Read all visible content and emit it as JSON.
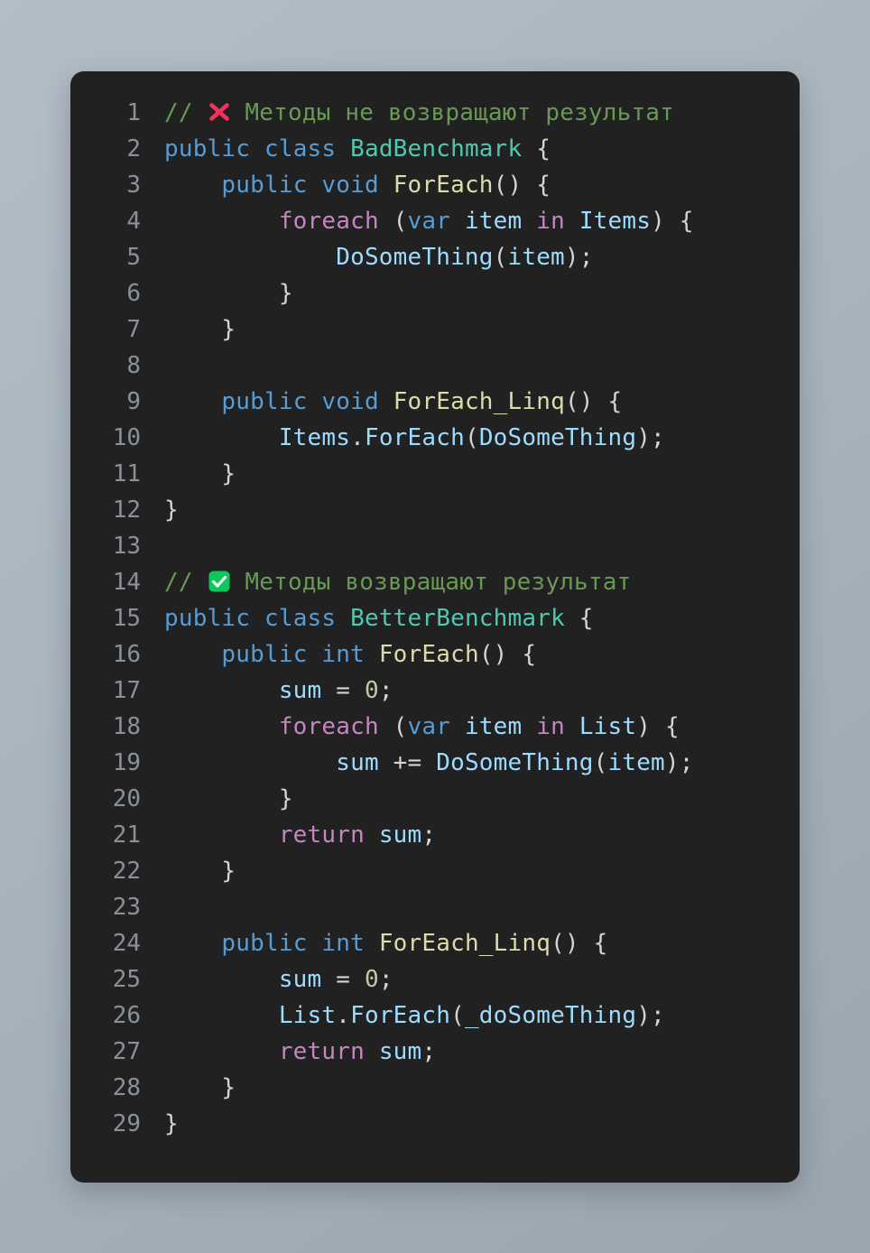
{
  "theme": {
    "page_background": "#aab5bf",
    "card_background": "#212121",
    "gutter_color": "#8a9199",
    "comment": "#6a9955",
    "keyword": "#569cd6",
    "control": "#c586c0",
    "type": "#4ec9b0",
    "method": "#dcdcaa",
    "variable": "#9cdcfe",
    "number": "#b5cea8",
    "punctuation": "#d4d4d4",
    "cross_mark_color": "#f5325b",
    "check_mark_color": "#0ac85b"
  },
  "code": {
    "language": "csharp",
    "line_count": 29,
    "lines": [
      {
        "number": "1",
        "indent": 0,
        "tokens": [
          {
            "text": "// ",
            "kind": "comment"
          },
          {
            "text": "❌",
            "kind": "emoji",
            "icon": "cross-mark-icon"
          },
          {
            "text": " Методы не возвращают результат",
            "kind": "comment"
          }
        ]
      },
      {
        "number": "2",
        "indent": 0,
        "tokens": [
          {
            "text": "public",
            "kind": "keyword"
          },
          {
            "text": " ",
            "kind": "punct"
          },
          {
            "text": "class",
            "kind": "keyword"
          },
          {
            "text": " ",
            "kind": "punct"
          },
          {
            "text": "BadBenchmark",
            "kind": "type"
          },
          {
            "text": " {",
            "kind": "punct"
          }
        ]
      },
      {
        "number": "3",
        "indent": 1,
        "tokens": [
          {
            "text": "public",
            "kind": "keyword"
          },
          {
            "text": " ",
            "kind": "punct"
          },
          {
            "text": "void",
            "kind": "keyword"
          },
          {
            "text": " ",
            "kind": "punct"
          },
          {
            "text": "ForEach",
            "kind": "method"
          },
          {
            "text": "() {",
            "kind": "punct"
          }
        ]
      },
      {
        "number": "4",
        "indent": 2,
        "tokens": [
          {
            "text": "foreach",
            "kind": "control"
          },
          {
            "text": " (",
            "kind": "punct"
          },
          {
            "text": "var",
            "kind": "keyword"
          },
          {
            "text": " ",
            "kind": "punct"
          },
          {
            "text": "item",
            "kind": "variable"
          },
          {
            "text": " ",
            "kind": "punct"
          },
          {
            "text": "in",
            "kind": "control"
          },
          {
            "text": " ",
            "kind": "punct"
          },
          {
            "text": "Items",
            "kind": "variable"
          },
          {
            "text": ") {",
            "kind": "punct"
          }
        ]
      },
      {
        "number": "5",
        "indent": 3,
        "tokens": [
          {
            "text": "DoSomeThing",
            "kind": "variable"
          },
          {
            "text": "(",
            "kind": "punct"
          },
          {
            "text": "item",
            "kind": "variable"
          },
          {
            "text": ");",
            "kind": "punct"
          }
        ]
      },
      {
        "number": "6",
        "indent": 2,
        "tokens": [
          {
            "text": "}",
            "kind": "punct"
          }
        ]
      },
      {
        "number": "7",
        "indent": 1,
        "tokens": [
          {
            "text": "}",
            "kind": "punct"
          }
        ]
      },
      {
        "number": "8",
        "indent": 0,
        "tokens": []
      },
      {
        "number": "9",
        "indent": 1,
        "tokens": [
          {
            "text": "public",
            "kind": "keyword"
          },
          {
            "text": " ",
            "kind": "punct"
          },
          {
            "text": "void",
            "kind": "keyword"
          },
          {
            "text": " ",
            "kind": "punct"
          },
          {
            "text": "ForEach_Linq",
            "kind": "method"
          },
          {
            "text": "() {",
            "kind": "punct"
          }
        ]
      },
      {
        "number": "10",
        "indent": 2,
        "tokens": [
          {
            "text": "Items",
            "kind": "variable"
          },
          {
            "text": ".",
            "kind": "punct"
          },
          {
            "text": "ForEach",
            "kind": "variable"
          },
          {
            "text": "(",
            "kind": "punct"
          },
          {
            "text": "DoSomeThing",
            "kind": "variable"
          },
          {
            "text": ");",
            "kind": "punct"
          }
        ]
      },
      {
        "number": "11",
        "indent": 1,
        "tokens": [
          {
            "text": "}",
            "kind": "punct"
          }
        ]
      },
      {
        "number": "12",
        "indent": 0,
        "tokens": [
          {
            "text": "}",
            "kind": "punct"
          }
        ]
      },
      {
        "number": "13",
        "indent": 0,
        "tokens": []
      },
      {
        "number": "14",
        "indent": 0,
        "tokens": [
          {
            "text": "// ",
            "kind": "comment"
          },
          {
            "text": "✅",
            "kind": "emoji",
            "icon": "check-mark-icon"
          },
          {
            "text": " Методы возвращают результат",
            "kind": "comment"
          }
        ]
      },
      {
        "number": "15",
        "indent": 0,
        "tokens": [
          {
            "text": "public",
            "kind": "keyword"
          },
          {
            "text": " ",
            "kind": "punct"
          },
          {
            "text": "class",
            "kind": "keyword"
          },
          {
            "text": " ",
            "kind": "punct"
          },
          {
            "text": "BetterBenchmark",
            "kind": "type"
          },
          {
            "text": " {",
            "kind": "punct"
          }
        ]
      },
      {
        "number": "16",
        "indent": 1,
        "tokens": [
          {
            "text": "public",
            "kind": "keyword"
          },
          {
            "text": " ",
            "kind": "punct"
          },
          {
            "text": "int",
            "kind": "keyword"
          },
          {
            "text": " ",
            "kind": "punct"
          },
          {
            "text": "ForEach",
            "kind": "method"
          },
          {
            "text": "() {",
            "kind": "punct"
          }
        ]
      },
      {
        "number": "17",
        "indent": 2,
        "tokens": [
          {
            "text": "sum",
            "kind": "variable"
          },
          {
            "text": " = ",
            "kind": "punct"
          },
          {
            "text": "0",
            "kind": "number"
          },
          {
            "text": ";",
            "kind": "punct"
          }
        ]
      },
      {
        "number": "18",
        "indent": 2,
        "tokens": [
          {
            "text": "foreach",
            "kind": "control"
          },
          {
            "text": " (",
            "kind": "punct"
          },
          {
            "text": "var",
            "kind": "keyword"
          },
          {
            "text": " ",
            "kind": "punct"
          },
          {
            "text": "item",
            "kind": "variable"
          },
          {
            "text": " ",
            "kind": "punct"
          },
          {
            "text": "in",
            "kind": "control"
          },
          {
            "text": " ",
            "kind": "punct"
          },
          {
            "text": "List",
            "kind": "variable"
          },
          {
            "text": ") {",
            "kind": "punct"
          }
        ]
      },
      {
        "number": "19",
        "indent": 3,
        "tokens": [
          {
            "text": "sum",
            "kind": "variable"
          },
          {
            "text": " += ",
            "kind": "punct"
          },
          {
            "text": "DoSomeThing",
            "kind": "variable"
          },
          {
            "text": "(",
            "kind": "punct"
          },
          {
            "text": "item",
            "kind": "variable"
          },
          {
            "text": ");",
            "kind": "punct"
          }
        ]
      },
      {
        "number": "20",
        "indent": 2,
        "tokens": [
          {
            "text": "}",
            "kind": "punct"
          }
        ]
      },
      {
        "number": "21",
        "indent": 2,
        "tokens": [
          {
            "text": "return",
            "kind": "control"
          },
          {
            "text": " ",
            "kind": "punct"
          },
          {
            "text": "sum",
            "kind": "variable"
          },
          {
            "text": ";",
            "kind": "punct"
          }
        ]
      },
      {
        "number": "22",
        "indent": 1,
        "tokens": [
          {
            "text": "}",
            "kind": "punct"
          }
        ]
      },
      {
        "number": "23",
        "indent": 0,
        "tokens": []
      },
      {
        "number": "24",
        "indent": 1,
        "tokens": [
          {
            "text": "public",
            "kind": "keyword"
          },
          {
            "text": " ",
            "kind": "punct"
          },
          {
            "text": "int",
            "kind": "keyword"
          },
          {
            "text": " ",
            "kind": "punct"
          },
          {
            "text": "ForEach_Linq",
            "kind": "method"
          },
          {
            "text": "() {",
            "kind": "punct"
          }
        ]
      },
      {
        "number": "25",
        "indent": 2,
        "tokens": [
          {
            "text": "sum",
            "kind": "variable"
          },
          {
            "text": " = ",
            "kind": "punct"
          },
          {
            "text": "0",
            "kind": "number"
          },
          {
            "text": ";",
            "kind": "punct"
          }
        ]
      },
      {
        "number": "26",
        "indent": 2,
        "tokens": [
          {
            "text": "List",
            "kind": "variable"
          },
          {
            "text": ".",
            "kind": "punct"
          },
          {
            "text": "ForEach",
            "kind": "variable"
          },
          {
            "text": "(",
            "kind": "punct"
          },
          {
            "text": "_doSomeThing",
            "kind": "variable"
          },
          {
            "text": ");",
            "kind": "punct"
          }
        ]
      },
      {
        "number": "27",
        "indent": 2,
        "tokens": [
          {
            "text": "return",
            "kind": "control"
          },
          {
            "text": " ",
            "kind": "punct"
          },
          {
            "text": "sum",
            "kind": "variable"
          },
          {
            "text": ";",
            "kind": "punct"
          }
        ]
      },
      {
        "number": "28",
        "indent": 1,
        "tokens": [
          {
            "text": "}",
            "kind": "punct"
          }
        ]
      },
      {
        "number": "29",
        "indent": 0,
        "tokens": [
          {
            "text": "}",
            "kind": "punct"
          }
        ]
      }
    ]
  }
}
